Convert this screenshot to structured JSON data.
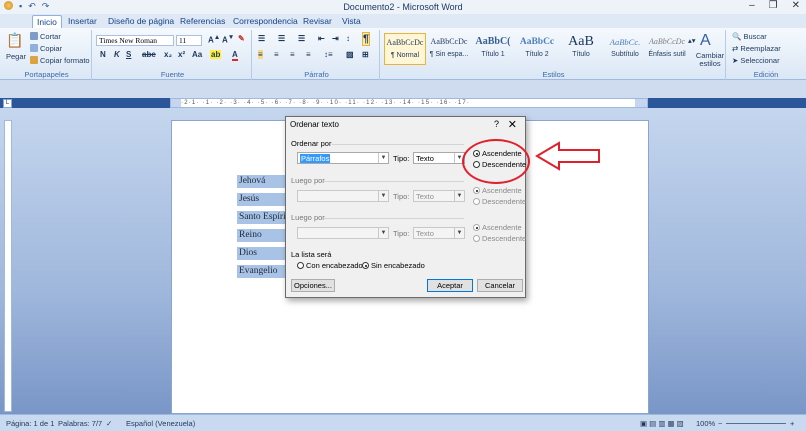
{
  "window": {
    "title": "Documento2 - Microsoft Word"
  },
  "quick_access": {
    "icons": [
      "save-icon",
      "undo-icon",
      "redo-icon"
    ]
  },
  "tabs": [
    "Inicio",
    "Insertar",
    "Diseño de página",
    "Referencias",
    "Correspondencia",
    "Revisar",
    "Vista"
  ],
  "ribbon": {
    "clipboard": {
      "paste_label": "Pegar",
      "cut_label": "Cortar",
      "copy_label": "Copiar",
      "format_painter_label": "Copiar formato",
      "group_label": "Portapapeles"
    },
    "font": {
      "font_name": "Times New Roman",
      "font_size": "11",
      "group_label": "Fuente",
      "bold": "N",
      "italic": "K",
      "underline": "S"
    },
    "paragraph": {
      "group_label": "Párrafo"
    },
    "styles": {
      "group_label": "Estilos",
      "items": [
        {
          "sample": "AaBbCcDc",
          "name": "¶ Normal",
          "selected": true
        },
        {
          "sample": "AaBbCcDc",
          "name": "¶ Sin espa..."
        },
        {
          "sample": "AaBbC(",
          "name": "Título 1"
        },
        {
          "sample": "AaBbCc",
          "name": "Título 2"
        },
        {
          "sample": "AaB",
          "name": "Título"
        },
        {
          "sample": "AaBbCc.",
          "name": "Subtítulo"
        },
        {
          "sample": "AaBbCcDc",
          "name": "Énfasis sutil"
        }
      ],
      "change_styles_label": "Cambiar estilos"
    },
    "editing": {
      "find_label": "Buscar",
      "replace_label": "Reemplazar",
      "select_label": "Seleccionar",
      "group_label": "Edición"
    }
  },
  "ruler": {
    "numbers": "·2·1·  ·1·  ·2·  ·3·  ·4·  ·5·  ·6·  ·7·  ·8·  ·9· ·10· ·11· ·12· ·13· ·14· ·15· ·16· ·17·"
  },
  "document": {
    "words": [
      "Jehová",
      "Jesús",
      "Santo Espíritu",
      "Reino",
      "Dios",
      "Evangelio"
    ]
  },
  "dialog": {
    "title": "Ordenar texto",
    "help": "?",
    "sort_by_label": "Ordenar por",
    "sort_by_value": "Párrafos",
    "type_label": "Tipo:",
    "type_value": "Texto",
    "asc_label": "Ascendente",
    "desc_label": "Descendente",
    "then_by_label": "Luego por",
    "then_by_label2": "Luego por",
    "list_is_label": "La lista será",
    "with_header_label": "Con encabezado",
    "without_header_label": "Sin encabezado",
    "options_button": "Opciones...",
    "ok_button": "Aceptar",
    "cancel_button": "Cancelar"
  },
  "annotation": {
    "color": "#e0202a"
  },
  "status": {
    "page": "Página: 1 de 1",
    "words": "Palabras: 7/7",
    "language": "Español (Venezuela)",
    "zoom": "100%"
  }
}
